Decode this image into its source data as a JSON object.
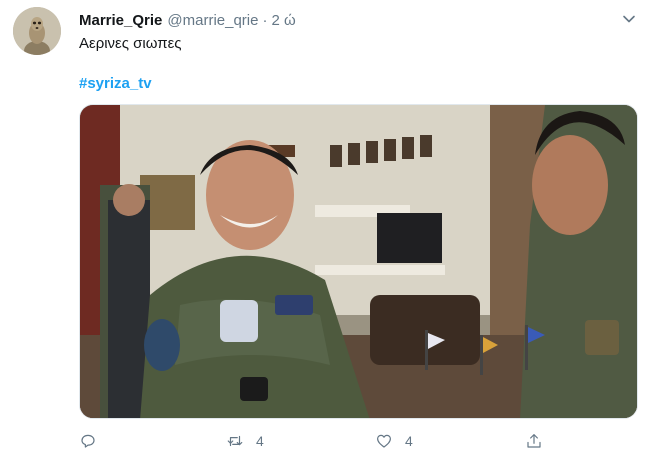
{
  "user": {
    "display_name": "Marrie_Qrie",
    "handle": "@marrie_qrie",
    "separator": "·",
    "time": "2 ώ",
    "avatar_icon": "meerkat-avatar"
  },
  "tweet": {
    "text": "Αερινες σιωπες",
    "hashtag": "#syriza_tv"
  },
  "media": {
    "type": "video-still"
  },
  "actions": {
    "reply_icon": "reply-icon",
    "reply_count": "",
    "retweet_icon": "retweet-icon",
    "retweet_count": "4",
    "like_icon": "heart-icon",
    "like_count": "4",
    "share_icon": "share-icon"
  },
  "colors": {
    "accent": "#1da1f2",
    "secondary_text": "#657786",
    "primary_text": "#14171a"
  }
}
